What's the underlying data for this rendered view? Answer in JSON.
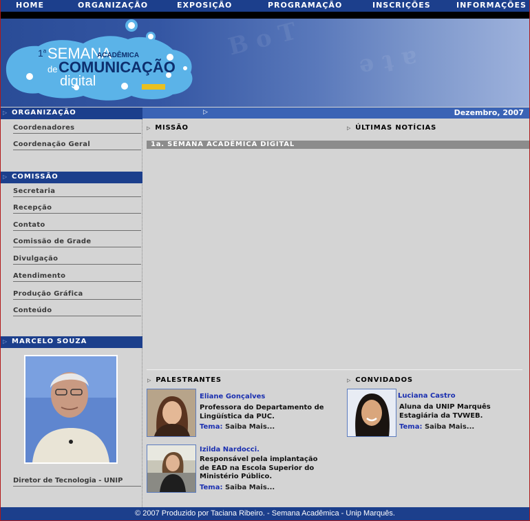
{
  "nav": [
    "HOME",
    "ORGANIZAÇÃO",
    "EXPOSIÇÃO",
    "PROGRAMAÇÃO",
    "INSCRIÇÕES",
    "INFORMAÇÕES"
  ],
  "logo": {
    "line1_num": "1",
    "line1_sup": "a",
    "line1_big": "SEMANA",
    "line1_small": "ACADÊMICA",
    "line2_de": "de",
    "line2_big": "COMUNICAÇÃO",
    "line3": "digital"
  },
  "date": "Dezembro, 2007",
  "sidebar": {
    "org_header": "ORGANIZAÇÃO",
    "org_links": [
      "Coordenadores",
      "Coordenação Geral"
    ],
    "com_header": "COMISSÃO",
    "com_links": [
      "Secretaria",
      "Recepção",
      "Contato",
      "Comissão de Grade",
      "Divulgação",
      "Atendimento",
      "Produção Gráfica",
      "Conteúdo"
    ],
    "person_header": "MARCELO SOUZA",
    "person_caption": "Diretor de Tecnologia - UNIP"
  },
  "main": {
    "missao": "MISSÃO",
    "noticias": "ÚLTIMAS NOTÍCIAS",
    "digital_bar": "1a. SEMANA ACADÊMICA DIGITAL",
    "palestrantes": "PALESTRANTES",
    "convidados": "CONVIDADOS"
  },
  "people": {
    "p1": {
      "name": "Eliane Gonçalves",
      "desc": "Professora do Departamento de Lingüística da PUC.",
      "tema": "Tema:",
      "more": "Saiba Mais..."
    },
    "p2": {
      "name": "Izilda Nardocci.",
      "desc": "Responsável pela implantação de EAD na Escola Superior do Ministério Público.",
      "tema": "Tema:",
      "more": "Saiba Mais..."
    },
    "c1": {
      "name": "Luciana Castro",
      "desc1": "Aluna da UNIP Marquês",
      "desc2": "Estagiária da TVWEB.",
      "tema": "Tema:",
      "more": "Saiba Mais..."
    }
  },
  "footer": "© 2007 Produzido por Taciana Ribeiro. -  Semana Acadêmica - Unip Marquês.",
  "colors": {
    "nav_blue": "#1c3f8c",
    "bar_blue": "#3a63b5",
    "background": "#d4d4d4",
    "link_blue": "#1a2fb0",
    "border_red": "#b01818"
  }
}
